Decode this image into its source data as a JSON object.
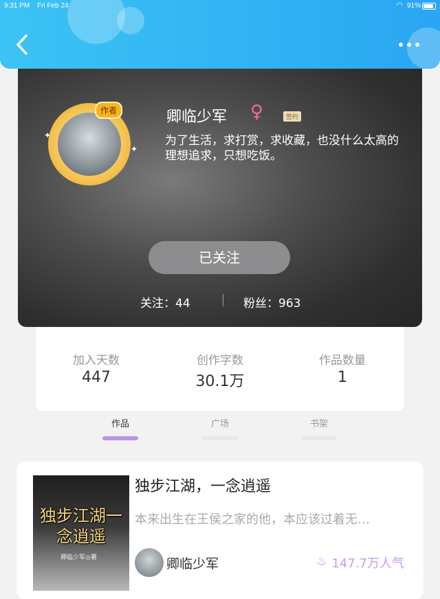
{
  "status": {
    "time": "9:31 PM",
    "date": "Fri Feb 24",
    "battery": "91%"
  },
  "header": {
    "back_icon": "chevron-left-icon",
    "more_icon": "more-dots-icon",
    "color": "#2aa6f2"
  },
  "profile": {
    "avatar_badge": "作者",
    "name": "卿临少军",
    "gender_symbol": "♀",
    "sign_badge": "签约",
    "bio": "为了生活，求打赏，求收藏，也没什么太高的理想追求，只想吃饭。",
    "follow_button": "已关注",
    "following": "关注：44",
    "fans": "粉丝：963"
  },
  "stats": [
    {
      "label": "加入天数",
      "value": "447"
    },
    {
      "label": "创作字数",
      "value": "30.1万"
    },
    {
      "label": "作品数量",
      "value": "1"
    }
  ],
  "tabs": [
    {
      "label": "作品",
      "active": true
    },
    {
      "label": "广场",
      "active": false
    },
    {
      "label": "书架",
      "active": false
    }
  ],
  "book": {
    "cover_title": "独步江湖一念逍遥",
    "cover_author": "卿临少军◎著",
    "title": "独步江湖，一念逍遥",
    "description": "本来出生在王侯之家的他，本应该过着无…",
    "author": "卿临少军",
    "popularity": "147.7万人气",
    "accent": "#c49bf0"
  }
}
